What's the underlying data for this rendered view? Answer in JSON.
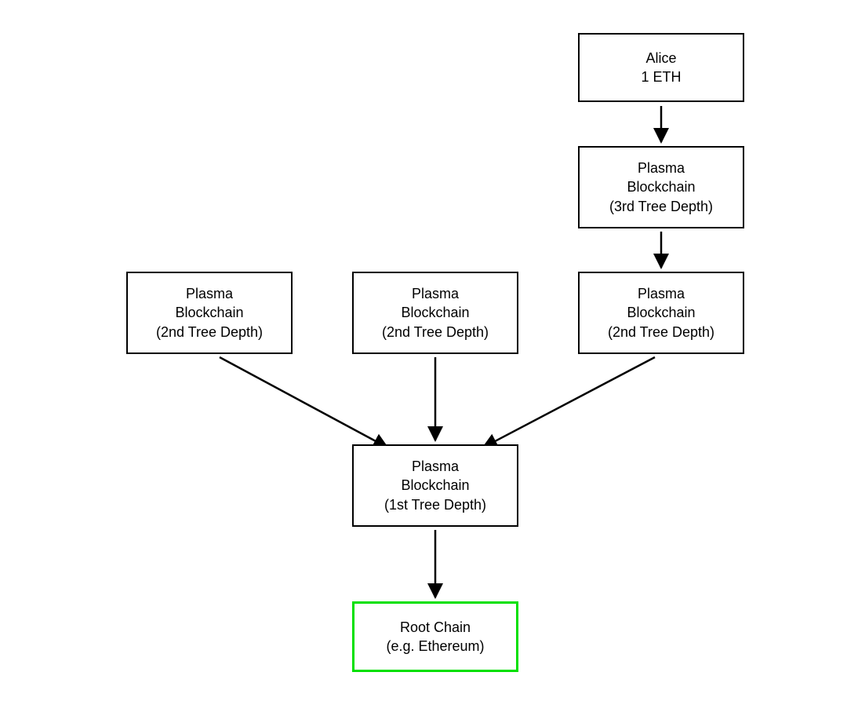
{
  "diagram": {
    "alice": {
      "line1": "Alice",
      "line2": "1 ETH"
    },
    "plasma3": {
      "line1": "Plasma",
      "line2": "Blockchain",
      "line3": "(3rd Tree Depth)"
    },
    "plasma2a": {
      "line1": "Plasma",
      "line2": "Blockchain",
      "line3": "(2nd Tree Depth)"
    },
    "plasma2b": {
      "line1": "Plasma",
      "line2": "Blockchain",
      "line3": "(2nd Tree Depth)"
    },
    "plasma2c": {
      "line1": "Plasma",
      "line2": "Blockchain",
      "line3": "(2nd Tree Depth)"
    },
    "plasma1": {
      "line1": "Plasma",
      "line2": "Blockchain",
      "line3": "(1st Tree Depth)"
    },
    "root": {
      "line1": "Root Chain",
      "line2": "(e.g. Ethereum)"
    }
  },
  "chart_data": {
    "type": "diagram",
    "title": "",
    "nodes": [
      {
        "id": "alice",
        "label": "Alice\n1 ETH"
      },
      {
        "id": "plasma3",
        "label": "Plasma Blockchain (3rd Tree Depth)"
      },
      {
        "id": "plasma2a",
        "label": "Plasma Blockchain (2nd Tree Depth)"
      },
      {
        "id": "plasma2b",
        "label": "Plasma Blockchain (2nd Tree Depth)"
      },
      {
        "id": "plasma2c",
        "label": "Plasma Blockchain (2nd Tree Depth)"
      },
      {
        "id": "plasma1",
        "label": "Plasma Blockchain (1st Tree Depth)"
      },
      {
        "id": "root",
        "label": "Root Chain (e.g. Ethereum)",
        "highlight": "green"
      }
    ],
    "edges": [
      {
        "from": "alice",
        "to": "plasma3"
      },
      {
        "from": "plasma3",
        "to": "plasma2c"
      },
      {
        "from": "plasma2a",
        "to": "plasma1"
      },
      {
        "from": "plasma2b",
        "to": "plasma1"
      },
      {
        "from": "plasma2c",
        "to": "plasma1"
      },
      {
        "from": "plasma1",
        "to": "root"
      }
    ]
  }
}
